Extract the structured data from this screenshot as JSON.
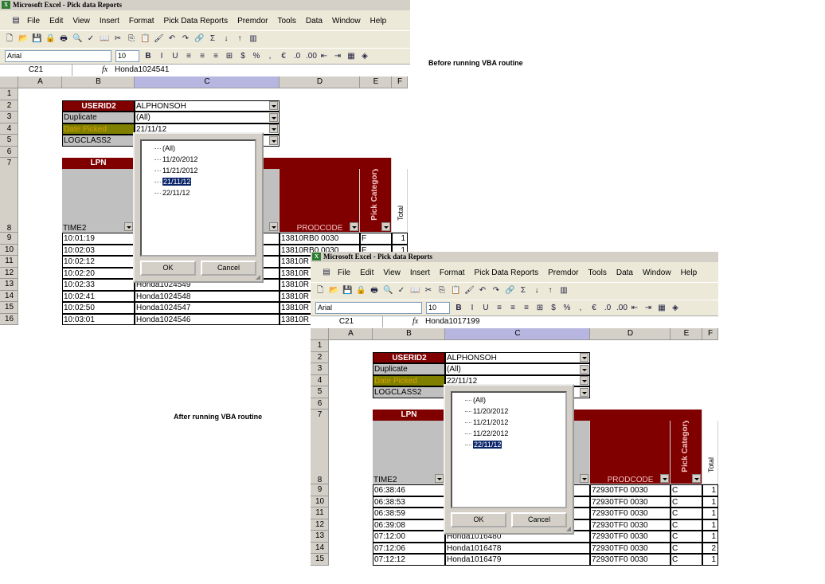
{
  "notes": {
    "before": "Before running VBA routine",
    "after": "After running VBA routine"
  },
  "app": {
    "title": "Microsoft Excel - Pick data Reports",
    "menu": [
      "File",
      "Edit",
      "View",
      "Insert",
      "Format",
      "Pick Data Reports",
      "Premdor",
      "Tools",
      "Data",
      "Window",
      "Help"
    ],
    "font_name": "Arial",
    "font_size": "10",
    "columns": [
      "A",
      "B",
      "C",
      "D",
      "E",
      "F"
    ],
    "pivot_labels": {
      "userid": "USERID2",
      "duplicate": "Duplicate",
      "date_picked": "Date Picked",
      "logclass": "LOGCLASS2",
      "lpn": "LPN",
      "time": "TIME2",
      "prodcode": "PRODCODE",
      "pick_category": "Pick Category",
      "total": "Total"
    },
    "ok": "OK",
    "cancel": "Cancel"
  },
  "windows": [
    {
      "name_box": "C21",
      "formula": "Honda1024541",
      "userid_value": "ALPHONSOH",
      "duplicate_value": "(All)",
      "date_value": "21/11/12",
      "logclass_value": "",
      "filter_items": [
        "(All)",
        "11/20/2012",
        "11/21/2012",
        "21/11/12",
        "22/11/12"
      ],
      "selected_item": "21/11/12",
      "rows": [
        {
          "n": "9",
          "time": "10:01:19",
          "lpn": "",
          "prod": "13810RB0 0030",
          "cat": "F",
          "total": "1"
        },
        {
          "n": "10",
          "time": "10:02:03",
          "lpn": "",
          "prod": "13810RB0 0030",
          "cat": "F",
          "total": "1"
        },
        {
          "n": "11",
          "time": "10:02:12",
          "lpn": "",
          "prod": "13810R",
          "cat": "",
          "total": ""
        },
        {
          "n": "12",
          "time": "10:02:20",
          "lpn": "",
          "prod": "13810R",
          "cat": "",
          "total": ""
        },
        {
          "n": "13",
          "time": "10:02:33",
          "lpn": "Honda1024549",
          "prod": "13810R",
          "cat": "",
          "total": ""
        },
        {
          "n": "14",
          "time": "10:02:41",
          "lpn": "Honda1024548",
          "prod": "13810R",
          "cat": "",
          "total": ""
        },
        {
          "n": "15",
          "time": "10:02:50",
          "lpn": "Honda1024547",
          "prod": "13810R",
          "cat": "",
          "total": ""
        },
        {
          "n": "16",
          "time": "10:03:01",
          "lpn": "Honda1024546",
          "prod": "13810R",
          "cat": "",
          "total": ""
        }
      ]
    },
    {
      "name_box": "C21",
      "formula": "Honda1017199",
      "userid_value": "ALPHONSOH",
      "duplicate_value": "(All)",
      "date_value": "22/11/12",
      "logclass_value": "",
      "filter_items": [
        "(All)",
        "11/20/2012",
        "11/21/2012",
        "11/22/2012",
        "22/11/12"
      ],
      "selected_item": "22/11/12",
      "rows": [
        {
          "n": "9",
          "time": "06:38:46",
          "lpn": "",
          "prod": "72930TF0 0030",
          "cat": "C",
          "total": "1"
        },
        {
          "n": "10",
          "time": "06:38:53",
          "lpn": "",
          "prod": "72930TF0 0030",
          "cat": "C",
          "total": "1"
        },
        {
          "n": "11",
          "time": "06:38:59",
          "lpn": "",
          "prod": "72930TF0 0030",
          "cat": "C",
          "total": "1"
        },
        {
          "n": "12",
          "time": "06:39:08",
          "lpn": "",
          "prod": "72930TF0 0030",
          "cat": "C",
          "total": "1"
        },
        {
          "n": "13",
          "time": "07:12:00",
          "lpn": "Honda1016480",
          "prod": "72930TF0 0030",
          "cat": "C",
          "total": "1"
        },
        {
          "n": "14",
          "time": "07:12:06",
          "lpn": "Honda1016478",
          "prod": "72930TF0 0030",
          "cat": "C",
          "total": "2"
        },
        {
          "n": "15",
          "time": "07:12:12",
          "lpn": "Honda1016479",
          "prod": "72930TF0 0030",
          "cat": "C",
          "total": "1"
        }
      ]
    }
  ]
}
